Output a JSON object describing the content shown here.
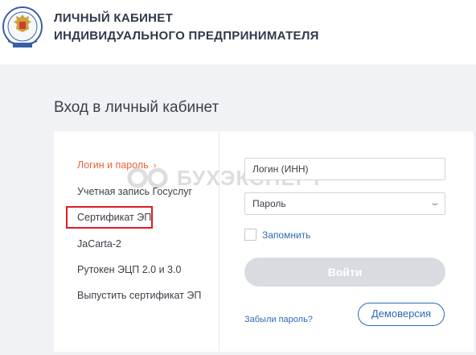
{
  "header": {
    "title_line1": "ЛИЧНЫЙ КАБИНЕТ",
    "title_line2": "ИНДИВИДУАЛЬНОГО ПРЕДПРИНИМАТЕЛЯ",
    "emblem_icon": "fns-emblem-icon"
  },
  "page": {
    "title": "Вход в личный кабинет"
  },
  "menu": {
    "items": [
      {
        "label": "Логин и пароль",
        "active": true
      },
      {
        "label": "Учетная запись Госуслуг",
        "active": false
      },
      {
        "label": "Сертификат ЭП",
        "active": false,
        "highlighted": true
      },
      {
        "label": "JaCarta-2",
        "active": false
      },
      {
        "label": "Рутокен ЭЦП 2.0 и 3.0",
        "active": false
      },
      {
        "label": "Выпустить сертификат ЭП",
        "active": false
      }
    ],
    "active_chevron": "›"
  },
  "form": {
    "login_placeholder": "Логин (ИНН)",
    "password_placeholder": "Пароль",
    "remember_label": "Запомнить",
    "remember_checked": false,
    "submit_label": "Войти",
    "forgot_label": "Забыли пароль?",
    "demo_label": "Демоверсия"
  },
  "watermark": {
    "text": "БУХЭКСПЕРТ"
  },
  "colors": {
    "accent_orange": "#e8623d",
    "link_blue": "#2d6bb6",
    "highlight_red": "#e31b23",
    "disabled_button": "#d8dbe0",
    "background": "#f0f2f5"
  }
}
